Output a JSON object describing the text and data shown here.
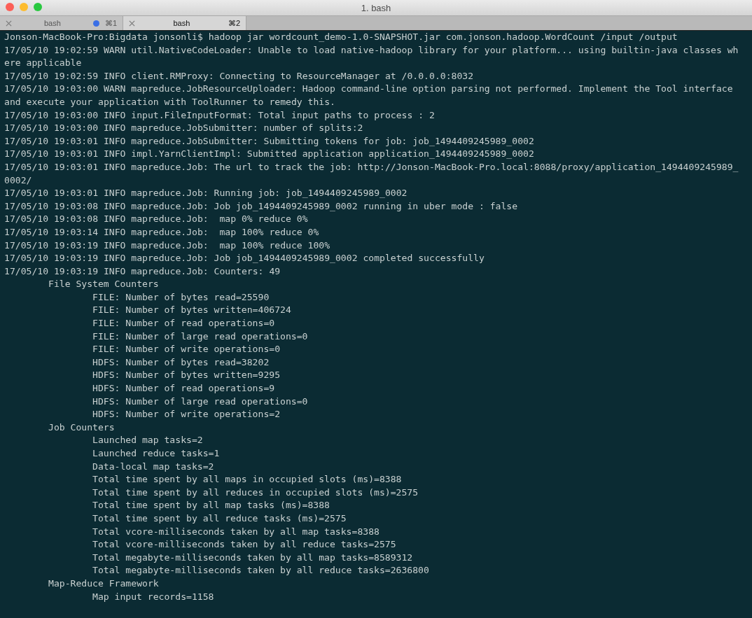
{
  "window": {
    "title": "1. bash"
  },
  "tabs": [
    {
      "label": "bash",
      "shortcut": "⌘1",
      "selected": false,
      "activity": true
    },
    {
      "label": "bash",
      "shortcut": "⌘2",
      "selected": true,
      "activity": false
    }
  ],
  "lines": [
    "Jonson-MacBook-Pro:Bigdata jonsonli$ hadoop jar wordcount_demo-1.0-SNAPSHOT.jar com.jonson.hadoop.WordCount /input /output",
    "17/05/10 19:02:59 WARN util.NativeCodeLoader: Unable to load native-hadoop library for your platform... using builtin-java classes wh",
    "ere applicable",
    "17/05/10 19:02:59 INFO client.RMProxy: Connecting to ResourceManager at /0.0.0.0:8032",
    "17/05/10 19:03:00 WARN mapreduce.JobResourceUploader: Hadoop command-line option parsing not performed. Implement the Tool interface",
    "and execute your application with ToolRunner to remedy this.",
    "17/05/10 19:03:00 INFO input.FileInputFormat: Total input paths to process : 2",
    "17/05/10 19:03:00 INFO mapreduce.JobSubmitter: number of splits:2",
    "17/05/10 19:03:01 INFO mapreduce.JobSubmitter: Submitting tokens for job: job_1494409245989_0002",
    "17/05/10 19:03:01 INFO impl.YarnClientImpl: Submitted application application_1494409245989_0002",
    "17/05/10 19:03:01 INFO mapreduce.Job: The url to track the job: http://Jonson-MacBook-Pro.local:8088/proxy/application_1494409245989_",
    "0002/",
    "17/05/10 19:03:01 INFO mapreduce.Job: Running job: job_1494409245989_0002",
    "17/05/10 19:03:08 INFO mapreduce.Job: Job job_1494409245989_0002 running in uber mode : false",
    "17/05/10 19:03:08 INFO mapreduce.Job:  map 0% reduce 0%",
    "17/05/10 19:03:14 INFO mapreduce.Job:  map 100% reduce 0%",
    "17/05/10 19:03:19 INFO mapreduce.Job:  map 100% reduce 100%",
    "17/05/10 19:03:19 INFO mapreduce.Job: Job job_1494409245989_0002 completed successfully",
    "17/05/10 19:03:19 INFO mapreduce.Job: Counters: 49"
  ],
  "counter_groups": [
    {
      "title": "File System Counters",
      "children": [
        "FILE: Number of bytes read=25590",
        "FILE: Number of bytes written=406724",
        "FILE: Number of read operations=0",
        "FILE: Number of large read operations=0",
        "FILE: Number of write operations=0",
        "HDFS: Number of bytes read=38202",
        "HDFS: Number of bytes written=9295",
        "HDFS: Number of read operations=9",
        "HDFS: Number of large read operations=0",
        "HDFS: Number of write operations=2"
      ]
    },
    {
      "title": "Job Counters",
      "children": [
        "Launched map tasks=2",
        "Launched reduce tasks=1",
        "Data-local map tasks=2",
        "Total time spent by all maps in occupied slots (ms)=8388",
        "Total time spent by all reduces in occupied slots (ms)=2575",
        "Total time spent by all map tasks (ms)=8388",
        "Total time spent by all reduce tasks (ms)=2575",
        "Total vcore-milliseconds taken by all map tasks=8388",
        "Total vcore-milliseconds taken by all reduce tasks=2575",
        "Total megabyte-milliseconds taken by all map tasks=8589312",
        "Total megabyte-milliseconds taken by all reduce tasks=2636800"
      ]
    },
    {
      "title": "Map-Reduce Framework",
      "children": [
        "Map input records=1158"
      ]
    }
  ]
}
